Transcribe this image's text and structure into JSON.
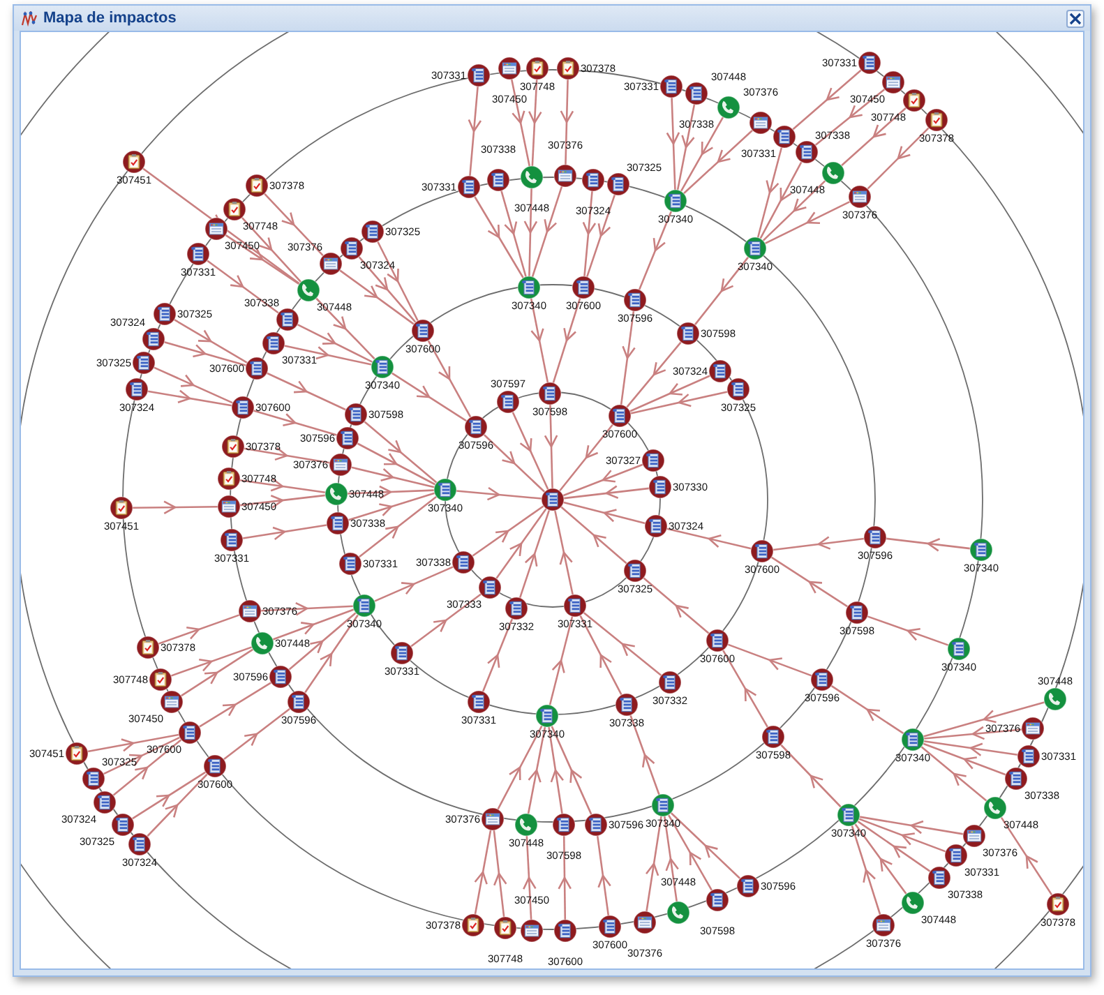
{
  "window": {
    "title": "Mapa de impactos"
  },
  "graph": {
    "root": {
      "kind": "list",
      "color": "#8e1b1f",
      "children": [
        {
          "label": "307340",
          "kind": "list",
          "color": "#14913f",
          "children": [
            {
              "label": "307598",
              "kind": "list",
              "color": "#8e1b1f",
              "children": [
                {
                  "label": "307600",
                  "kind": "list",
                  "color": "#8e1b1f",
                  "children": [
                    {
                      "label": "307325",
                      "kind": "list",
                      "color": "#8e1b1f"
                    },
                    {
                      "label": "307324",
                      "kind": "list",
                      "color": "#8e1b1f"
                    }
                  ]
                }
              ]
            },
            {
              "label": "307596",
              "kind": "list",
              "color": "#8e1b1f",
              "children": [
                {
                  "label": "307600",
                  "kind": "list",
                  "color": "#8e1b1f",
                  "children": [
                    {
                      "label": "307325",
                      "kind": "list",
                      "color": "#8e1b1f"
                    },
                    {
                      "label": "307324",
                      "kind": "list",
                      "color": "#8e1b1f"
                    }
                  ]
                }
              ]
            },
            {
              "label": "307376",
              "kind": "calendar",
              "color": "#8e1b1f",
              "children": [
                {
                  "label": "307378",
                  "kind": "clipboard",
                  "color": "#8e1b1f"
                }
              ]
            },
            {
              "label": "307448",
              "kind": "phone",
              "color": "#14913f",
              "children": [
                {
                  "label": "307748",
                  "kind": "clipboard",
                  "color": "#8e1b1f"
                },
                {
                  "label": "307450",
                  "kind": "calendar",
                  "color": "#8e1b1f",
                  "children": [
                    {
                      "label": "307451",
                      "kind": "clipboard",
                      "color": "#8e1b1f"
                    }
                  ]
                }
              ]
            },
            {
              "label": "307338",
              "kind": "list",
              "color": "#8e1b1f",
              "children": [
                {
                  "label": "307331",
                  "kind": "list",
                  "color": "#8e1b1f"
                }
              ]
            },
            {
              "label": "307331",
              "kind": "list",
              "color": "#8e1b1f"
            }
          ]
        },
        {
          "label": "307596",
          "kind": "list",
          "color": "#8e1b1f",
          "children": [
            {
              "label": "307340",
              "kind": "list",
              "color": "#14913f",
              "children": [
                {
                  "label": "307448",
                  "kind": "phone",
                  "color": "#14913f",
                  "children": [
                    {
                      "label": "307451",
                      "kind": "clipboard",
                      "color": "#8e1b1f"
                    },
                    {
                      "label": "307748",
                      "kind": "clipboard",
                      "color": "#8e1b1f"
                    },
                    {
                      "label": "307450",
                      "kind": "calendar",
                      "color": "#8e1b1f"
                    }
                  ]
                },
                {
                  "label": "307338",
                  "kind": "list",
                  "color": "#8e1b1f",
                  "children": [
                    {
                      "label": "307331",
                      "kind": "list",
                      "color": "#8e1b1f"
                    }
                  ]
                },
                {
                  "label": "307331",
                  "kind": "list",
                  "color": "#8e1b1f"
                }
              ]
            },
            {
              "label": "307600",
              "kind": "list",
              "color": "#8e1b1f",
              "children": [
                {
                  "label": "307376",
                  "kind": "calendar",
                  "color": "#8e1b1f",
                  "children": [
                    {
                      "label": "307378",
                      "kind": "clipboard",
                      "color": "#8e1b1f"
                    }
                  ]
                },
                {
                  "label": "307324",
                  "kind": "list",
                  "color": "#8e1b1f"
                },
                {
                  "label": "307325",
                  "kind": "list",
                  "color": "#8e1b1f"
                }
              ]
            }
          ]
        },
        {
          "label": "307597",
          "kind": "list",
          "color": "#8e1b1f"
        },
        {
          "label": "307598",
          "kind": "list",
          "color": "#8e1b1f",
          "children": [
            {
              "label": "307340",
              "kind": "list",
              "color": "#14913f",
              "children": [
                {
                  "label": "307331",
                  "kind": "list",
                  "color": "#8e1b1f",
                  "children": [
                    {
                      "label": "307331",
                      "kind": "list",
                      "color": "#8e1b1f"
                    }
                  ]
                },
                {
                  "label": "307338",
                  "kind": "list",
                  "color": "#8e1b1f"
                },
                {
                  "label": "307448",
                  "kind": "phone",
                  "color": "#14913f",
                  "children": [
                    {
                      "label": "307450",
                      "kind": "calendar",
                      "color": "#8e1b1f"
                    },
                    {
                      "label": "307748",
                      "kind": "clipboard",
                      "color": "#8e1b1f"
                    }
                  ]
                },
                {
                  "label": "307376",
                  "kind": "calendar",
                  "color": "#8e1b1f",
                  "children": [
                    {
                      "label": "307378",
                      "kind": "clipboard",
                      "color": "#8e1b1f"
                    }
                  ]
                }
              ]
            },
            {
              "label": "307600",
              "kind": "list",
              "color": "#8e1b1f",
              "children": [
                {
                  "label": "307324",
                  "kind": "list",
                  "color": "#8e1b1f"
                },
                {
                  "label": "307325",
                  "kind": "list",
                  "color": "#8e1b1f"
                }
              ]
            }
          ]
        },
        {
          "label": "307600",
          "kind": "list",
          "color": "#8e1b1f",
          "children": [
            {
              "label": "307596",
              "kind": "list",
              "color": "#8e1b1f",
              "children": [
                {
                  "label": "307340",
                  "kind": "list",
                  "color": "#14913f",
                  "children": [
                    {
                      "label": "307331",
                      "kind": "list",
                      "color": "#8e1b1f"
                    },
                    {
                      "label": "307338",
                      "kind": "list",
                      "color": "#8e1b1f"
                    },
                    {
                      "label": "307448",
                      "kind": "phone",
                      "color": "#14913f"
                    },
                    {
                      "label": "307376",
                      "kind": "calendar",
                      "color": "#8e1b1f"
                    }
                  ]
                }
              ]
            },
            {
              "label": "307598",
              "kind": "list",
              "color": "#8e1b1f",
              "children": [
                {
                  "label": "307340",
                  "kind": "list",
                  "color": "#14913f",
                  "children": [
                    {
                      "label": "307331",
                      "kind": "list",
                      "color": "#8e1b1f",
                      "children": [
                        {
                          "label": "307331",
                          "kind": "list",
                          "color": "#8e1b1f"
                        }
                      ]
                    },
                    {
                      "label": "307338",
                      "kind": "list",
                      "color": "#8e1b1f",
                      "children": [
                        {
                          "label": "307450",
                          "kind": "calendar",
                          "color": "#8e1b1f"
                        }
                      ]
                    },
                    {
                      "label": "307448",
                      "kind": "phone",
                      "color": "#14913f",
                      "children": [
                        {
                          "label": "307748",
                          "kind": "clipboard",
                          "color": "#8e1b1f"
                        }
                      ]
                    },
                    {
                      "label": "307376",
                      "kind": "calendar",
                      "color": "#8e1b1f",
                      "children": [
                        {
                          "label": "307378",
                          "kind": "clipboard",
                          "color": "#8e1b1f"
                        }
                      ]
                    }
                  ]
                }
              ]
            },
            {
              "label": "307324",
              "kind": "list",
              "color": "#8e1b1f"
            },
            {
              "label": "307325",
              "kind": "list",
              "color": "#8e1b1f"
            }
          ]
        },
        {
          "label": "307327",
          "kind": "list",
          "color": "#8e1b1f"
        },
        {
          "label": "307330",
          "kind": "list",
          "color": "#8e1b1f"
        },
        {
          "label": "307324",
          "kind": "list",
          "color": "#8e1b1f",
          "children": [
            {
              "label": "307600",
              "kind": "list",
              "color": "#8e1b1f",
              "children": [
                {
                  "label": "307596",
                  "kind": "list",
                  "color": "#8e1b1f",
                  "children": [
                    {
                      "label": "307340",
                      "kind": "list",
                      "color": "#14913f"
                    }
                  ]
                },
                {
                  "label": "307598",
                  "kind": "list",
                  "color": "#8e1b1f",
                  "children": [
                    {
                      "label": "307340",
                      "kind": "list",
                      "color": "#14913f"
                    }
                  ]
                }
              ]
            }
          ]
        },
        {
          "label": "307325",
          "kind": "list",
          "color": "#8e1b1f",
          "children": [
            {
              "label": "307600",
              "kind": "list",
              "color": "#8e1b1f",
              "children": [
                {
                  "label": "307596",
                  "kind": "list",
                  "color": "#8e1b1f",
                  "children": [
                    {
                      "label": "307340",
                      "kind": "list",
                      "color": "#14913f",
                      "children": [
                        {
                          "label": "307448",
                          "kind": "phone",
                          "color": "#14913f"
                        },
                        {
                          "label": "307376",
                          "kind": "calendar",
                          "color": "#8e1b1f"
                        },
                        {
                          "label": "307331",
                          "kind": "list",
                          "color": "#8e1b1f"
                        },
                        {
                          "label": "307338",
                          "kind": "list",
                          "color": "#8e1b1f"
                        },
                        {
                          "label": "307448",
                          "kind": "phone",
                          "color": "#14913f",
                          "children": [
                            {
                              "label": "307378",
                              "kind": "clipboard",
                              "color": "#8e1b1f"
                            }
                          ]
                        }
                      ]
                    }
                  ]
                },
                {
                  "label": "307598",
                  "kind": "list",
                  "color": "#8e1b1f",
                  "children": [
                    {
                      "label": "307340",
                      "kind": "list",
                      "color": "#14913f",
                      "children": [
                        {
                          "label": "307376",
                          "kind": "calendar",
                          "color": "#8e1b1f"
                        },
                        {
                          "label": "307331",
                          "kind": "list",
                          "color": "#8e1b1f"
                        },
                        {
                          "label": "307338",
                          "kind": "list",
                          "color": "#8e1b1f"
                        },
                        {
                          "label": "307448",
                          "kind": "phone",
                          "color": "#14913f"
                        },
                        {
                          "label": "307376",
                          "kind": "calendar",
                          "color": "#8e1b1f"
                        }
                      ]
                    }
                  ]
                }
              ]
            }
          ]
        },
        {
          "label": "307331",
          "kind": "list",
          "color": "#8e1b1f",
          "children": [
            {
              "label": "307340",
              "kind": "list",
              "color": "#14913f",
              "children": [
                {
                  "label": "307376",
                  "kind": "calendar",
                  "color": "#8e1b1f",
                  "children": [
                    {
                      "label": "307378",
                      "kind": "clipboard",
                      "color": "#8e1b1f"
                    },
                    {
                      "label": "307748",
                      "kind": "clipboard",
                      "color": "#8e1b1f"
                    }
                  ]
                },
                {
                  "label": "307448",
                  "kind": "phone",
                  "color": "#14913f",
                  "children": [
                    {
                      "label": "307450",
                      "kind": "calendar",
                      "color": "#8e1b1f"
                    }
                  ]
                },
                {
                  "label": "307598",
                  "kind": "list",
                  "color": "#8e1b1f",
                  "children": [
                    {
                      "label": "307600",
                      "kind": "list",
                      "color": "#8e1b1f"
                    }
                  ]
                },
                {
                  "label": "307596",
                  "kind": "list",
                  "color": "#8e1b1f",
                  "children": [
                    {
                      "label": "307600",
                      "kind": "list",
                      "color": "#8e1b1f"
                    }
                  ]
                }
              ]
            },
            {
              "label": "307332",
              "kind": "list",
              "color": "#8e1b1f"
            },
            {
              "label": "307338",
              "kind": "list",
              "color": "#8e1b1f",
              "children": [
                {
                  "label": "307340",
                  "kind": "list",
                  "color": "#14913f",
                  "children": [
                    {
                      "label": "307376",
                      "kind": "calendar",
                      "color": "#8e1b1f"
                    },
                    {
                      "label": "307448",
                      "kind": "phone",
                      "color": "#14913f"
                    },
                    {
                      "label": "307598",
                      "kind": "list",
                      "color": "#8e1b1f"
                    },
                    {
                      "label": "307596",
                      "kind": "list",
                      "color": "#8e1b1f"
                    }
                  ]
                }
              ]
            }
          ]
        },
        {
          "label": "307333",
          "kind": "list",
          "color": "#8e1b1f",
          "children": [
            {
              "label": "307331",
              "kind": "list",
              "color": "#8e1b1f"
            }
          ]
        },
        {
          "label": "307332",
          "kind": "list",
          "color": "#8e1b1f",
          "children": [
            {
              "label": "307331",
              "kind": "list",
              "color": "#8e1b1f"
            }
          ]
        },
        {
          "label": "307338",
          "kind": "list",
          "color": "#8e1b1f",
          "children": [
            {
              "label": "307340",
              "kind": "list",
              "color": "#14913f",
              "children": [
                {
                  "label": "307376",
                  "kind": "calendar",
                  "color": "#8e1b1f",
                  "children": [
                    {
                      "label": "307378",
                      "kind": "clipboard",
                      "color": "#8e1b1f"
                    }
                  ]
                },
                {
                  "label": "307448",
                  "kind": "phone",
                  "color": "#14913f",
                  "children": [
                    {
                      "label": "307748",
                      "kind": "clipboard",
                      "color": "#8e1b1f"
                    },
                    {
                      "label": "307450",
                      "kind": "calendar",
                      "color": "#8e1b1f"
                    }
                  ]
                },
                {
                  "label": "307596",
                  "kind": "list",
                  "color": "#8e1b1f",
                  "children": [
                    {
                      "label": "307600",
                      "kind": "list",
                      "color": "#8e1b1f",
                      "children": [
                        {
                          "label": "307451",
                          "kind": "clipboard",
                          "color": "#8e1b1f"
                        },
                        {
                          "label": "307325",
                          "kind": "list",
                          "color": "#8e1b1f"
                        },
                        {
                          "label": "307324",
                          "kind": "list",
                          "color": "#8e1b1f"
                        }
                      ]
                    }
                  ]
                },
                {
                  "label": "307596",
                  "kind": "list",
                  "color": "#8e1b1f",
                  "children": [
                    {
                      "label": "307600",
                      "kind": "list",
                      "color": "#8e1b1f",
                      "children": [
                        {
                          "label": "307325",
                          "kind": "list",
                          "color": "#8e1b1f"
                        },
                        {
                          "label": "307324",
                          "kind": "list",
                          "color": "#8e1b1f"
                        }
                      ]
                    }
                  ]
                }
              ]
            }
          ]
        }
      ]
    }
  }
}
